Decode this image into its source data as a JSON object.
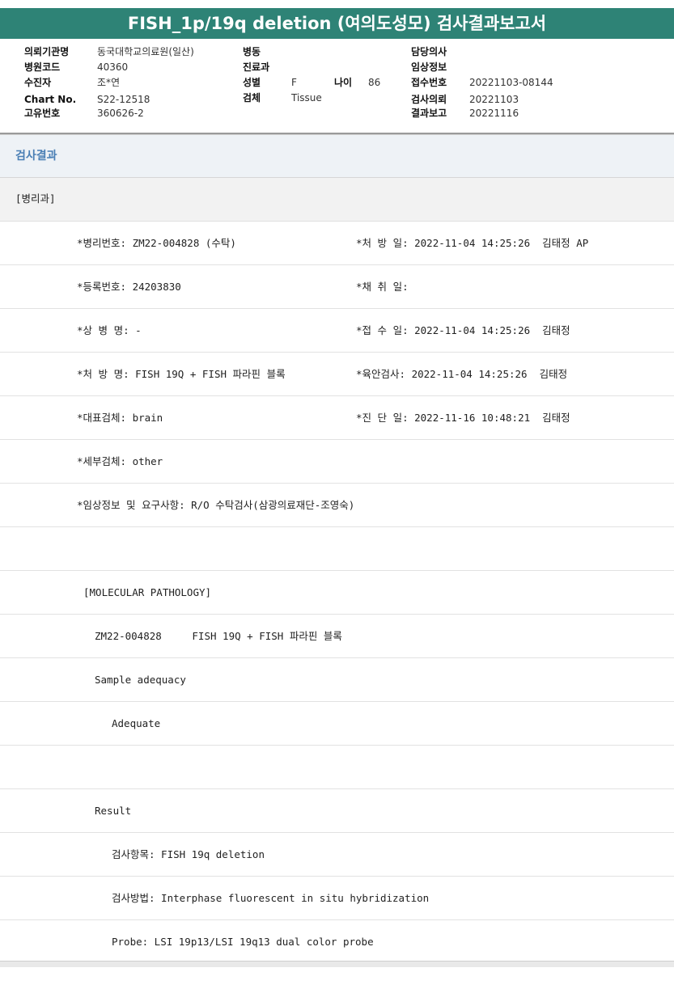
{
  "report": {
    "title": "FISH_1p/19q deletion (여의도성모) 검사결과보고서"
  },
  "header_info": {
    "col1": [
      {
        "label": "의뢰기관명",
        "value": "동국대학교의료원(일산)"
      },
      {
        "label": "병원코드",
        "value": "40360"
      },
      {
        "label": "수진자",
        "value": "조*연"
      },
      {
        "label": "Chart No.",
        "value": "S22-12518"
      },
      {
        "label": "고유번호",
        "value": "360626-2"
      }
    ],
    "col2": [
      {
        "label": "병동",
        "value": ""
      },
      {
        "label": "진료과",
        "value": ""
      },
      {
        "label": "성별",
        "value": "F"
      },
      {
        "label": "검체",
        "value": "Tissue"
      }
    ],
    "age": {
      "label": "나이",
      "value": "86"
    },
    "col3": [
      {
        "label": "담당의사",
        "value": ""
      },
      {
        "label": "임상정보",
        "value": ""
      },
      {
        "label": "접수번호",
        "value": "20221103-08144"
      },
      {
        "label": "검사의뢰",
        "value": "20221103"
      },
      {
        "label": "결과보고",
        "value": "20221116"
      }
    ]
  },
  "section": {
    "title": "검사결과",
    "department": "[병리과]"
  },
  "rows": [
    {
      "left": "*병리번호: ZM22-004828 (수탁)",
      "right": "*처 방 일: 2022-11-04 14:25:26  김태정 AP"
    },
    {
      "left": "*등록번호: 24203830",
      "right": "*채 취 일:"
    },
    {
      "left": "*상 병 명: -",
      "right": "*접 수 일: 2022-11-04 14:25:26  김태정"
    },
    {
      "left": "*처 방 명: FISH 19Q + FISH 파라핀 블록",
      "right": "*육안검사: 2022-11-04 14:25:26  김태정"
    },
    {
      "left": "*대표검체: brain",
      "right": "*진 단 일: 2022-11-16 10:48:21  김태정"
    },
    {
      "left": "*세부검체: other",
      "right": ""
    },
    {
      "left": "*임상정보 및 요구사항: R/O 수탁검사(삼광의료재단-조영숙)",
      "right": ""
    }
  ],
  "result_lines": [
    "",
    "[MOLECULAR PATHOLOGY]",
    "ZM22-004828     FISH 19Q + FISH 파라핀 블록",
    "Sample adequacy",
    "Adequate",
    "",
    "Result",
    "검사항목: FISH 19q deletion",
    "검사방법: Interphase fluorescent in situ hybridization",
    "Probe: LSI 19p13/LSI 19q13 dual color probe"
  ]
}
